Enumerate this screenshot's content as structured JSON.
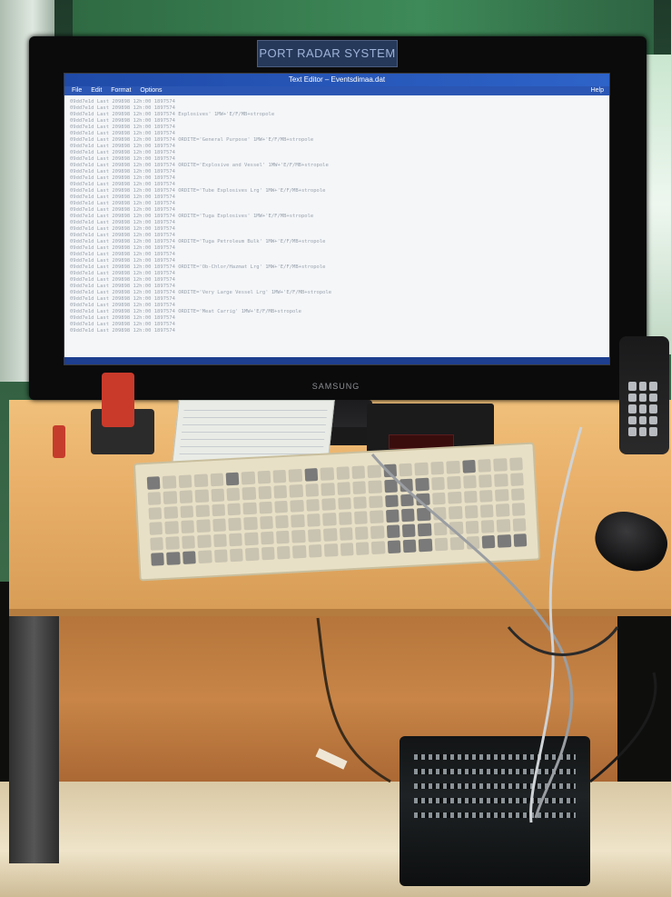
{
  "scene": {
    "monitor_label": "PORT RADAR SYSTEM",
    "monitor_brand": "SAMSUNG"
  },
  "app": {
    "window_title": "Text Editor – Eventsdimaa.dat",
    "menu": [
      "File",
      "Edit",
      "Format",
      "Options"
    ],
    "help_label": "Help",
    "status_text": "",
    "text_lines": [
      "09dd7e1d Last 209898 12h:00 1897574",
      "09dd7e1d Last 209898 12h:00 1897574",
      "09dd7e1d Last 209898 12h:00 1897574 Explosives' 1MW+'E/F/MB+stropole",
      "09dd7e1d Last 209898 12h:00 1897574",
      "09dd7e1d Last 209898 12h:00 1897574",
      "09dd7e1d Last 209898 12h:00 1897574",
      "09dd7e1d Last 209898 12h:00 1897574 ORDITE='General Purpose' 1MW+'E/F/MB+stropole",
      "09dd7e1d Last 209898 12h:00 1897574",
      "09dd7e1d Last 209898 12h:00 1897574",
      "09dd7e1d Last 209898 12h:00 1897574",
      "09dd7e1d Last 209898 12h:00 1897574 ORDITE='Explosive and Vessel' 1MW+'E/F/MB+stropole",
      "09dd7e1d Last 209898 12h:00 1897574",
      "09dd7e1d Last 209898 12h:00 1897574",
      "09dd7e1d Last 209898 12h:00 1897574",
      "09dd7e1d Last 209898 12h:00 1897574 ORDITE='Tube Explosives Lrg' 1MW+'E/F/MB+stropole",
      "09dd7e1d Last 209898 12h:00 1897574",
      "09dd7e1d Last 209898 12h:00 1897574",
      "09dd7e1d Last 209898 12h:00 1897574",
      "09dd7e1d Last 209898 12h:00 1897574 ORDITE='Tuga Explosives' 1MW+'E/F/MB+stropole",
      "09dd7e1d Last 209898 12h:00 1897574",
      "09dd7e1d Last 209898 12h:00 1897574",
      "09dd7e1d Last 209898 12h:00 1897574",
      "09dd7e1d Last 209898 12h:00 1897574 ORDITE='Tuga Petroleum Bulk' 1MW+'E/F/MB+stropole",
      "09dd7e1d Last 209898 12h:00 1897574",
      "09dd7e1d Last 209898 12h:00 1897574",
      "09dd7e1d Last 209898 12h:00 1897574",
      "09dd7e1d Last 209898 12h:00 1897574 ORDITE='Ob-Chlor/Hazmat Lrg' 1MW+'E/F/MB+stropole",
      "09dd7e1d Last 209898 12h:00 1897574",
      "09dd7e1d Last 209898 12h:00 1897574",
      "09dd7e1d Last 209898 12h:00 1897574",
      "09dd7e1d Last 209898 12h:00 1897574 ORDITE='Very Large Vessel Lrg' 1MW+'E/F/MB+stropole",
      "09dd7e1d Last 209898 12h:00 1897574",
      "09dd7e1d Last 209898 12h:00 1897574",
      "09dd7e1d Last 209898 12h:00 1897574 ORDITE='Meat Carrig' 1MW+'E/F/MB+stropole",
      "09dd7e1d Last 209898 12h:00 1897574",
      "09dd7e1d Last 209898 12h:00 1897574",
      "09dd7e1d Last 209898 12h:00 1897574"
    ]
  },
  "colors": {
    "titlebar": "#1f4aa8",
    "screen_bg": "#f4f6f8",
    "desk": "#e9b06a",
    "stapler": "#c93a2b"
  }
}
